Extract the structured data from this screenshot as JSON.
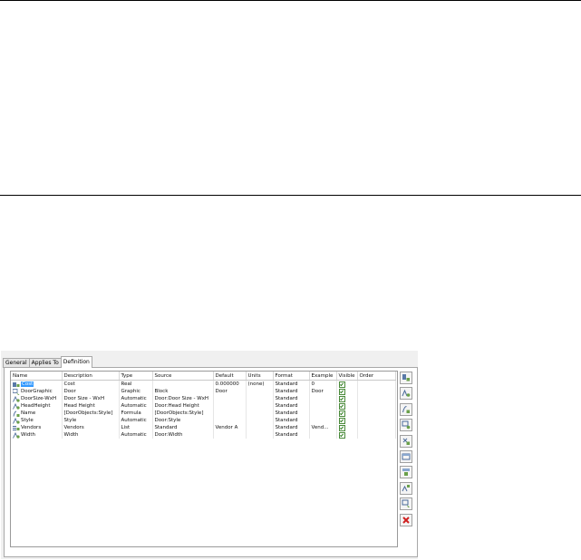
{
  "tabs": [
    {
      "label": "General"
    },
    {
      "label": "Applies To"
    },
    {
      "label": "Definition"
    }
  ],
  "columns": [
    "Name",
    "Description",
    "Type",
    "Source",
    "Default",
    "Units",
    "Format",
    "Example",
    "Visible",
    "Order"
  ],
  "rows": [
    {
      "name": "Cost",
      "description": "Cost",
      "type": "Real",
      "source": "",
      "default": "0.000000",
      "units": "(none)",
      "format": "Standard",
      "example": "0",
      "visible": true,
      "order": "",
      "icon": "manual-property-icon",
      "selected": true
    },
    {
      "name": "DoorGraphic",
      "description": "Door",
      "type": "Graphic",
      "source": "Block",
      "default": "Door",
      "units": "",
      "format": "Standard",
      "example": "Door",
      "visible": true,
      "order": "",
      "icon": "graphic-property-icon"
    },
    {
      "name": "DoorSize-WxH",
      "description": "Door Size - WxH",
      "type": "Automatic",
      "source": "Door:Door Size - WxH",
      "default": "",
      "units": "",
      "format": "Standard",
      "example": "",
      "visible": true,
      "order": "",
      "icon": "automatic-property-icon"
    },
    {
      "name": "HeadHeight",
      "description": "Head Height",
      "type": "Automatic",
      "source": "Door:Head Height",
      "default": "",
      "units": "",
      "format": "Standard",
      "example": "",
      "visible": true,
      "order": "",
      "icon": "automatic-property-icon"
    },
    {
      "name": "Name",
      "description": "[DoorObjects:Style]",
      "type": "Formula",
      "source": "[DoorObjects:Style]",
      "default": "",
      "units": "",
      "format": "Standard",
      "example": "",
      "visible": true,
      "order": "",
      "icon": "formula-property-icon"
    },
    {
      "name": "Style",
      "description": "Style",
      "type": "Automatic",
      "source": "Door:Style",
      "default": "",
      "units": "",
      "format": "Standard",
      "example": "",
      "visible": true,
      "order": "",
      "icon": "automatic-property-icon"
    },
    {
      "name": "Vendors",
      "description": "Vendors",
      "type": "List",
      "source": "Standard",
      "default": "Vendor A",
      "units": "",
      "format": "Standard",
      "example": "Vend...",
      "visible": true,
      "order": "",
      "icon": "list-property-icon"
    },
    {
      "name": "Width",
      "description": "Width",
      "type": "Automatic",
      "source": "Door:Width",
      "default": "",
      "units": "",
      "format": "Standard",
      "example": "",
      "visible": true,
      "order": "",
      "icon": "automatic-property-icon"
    }
  ],
  "side_buttons": [
    "add-manual-property-icon",
    "add-automatic-property-icon",
    "add-formula-property-icon",
    "add-anchor-property-icon",
    "add-location-property-icon",
    "add-classification-property-icon",
    "add-material-property-icon",
    "add-project-property-icon",
    "add-graphic-property-icon",
    "delete-property-icon"
  ]
}
